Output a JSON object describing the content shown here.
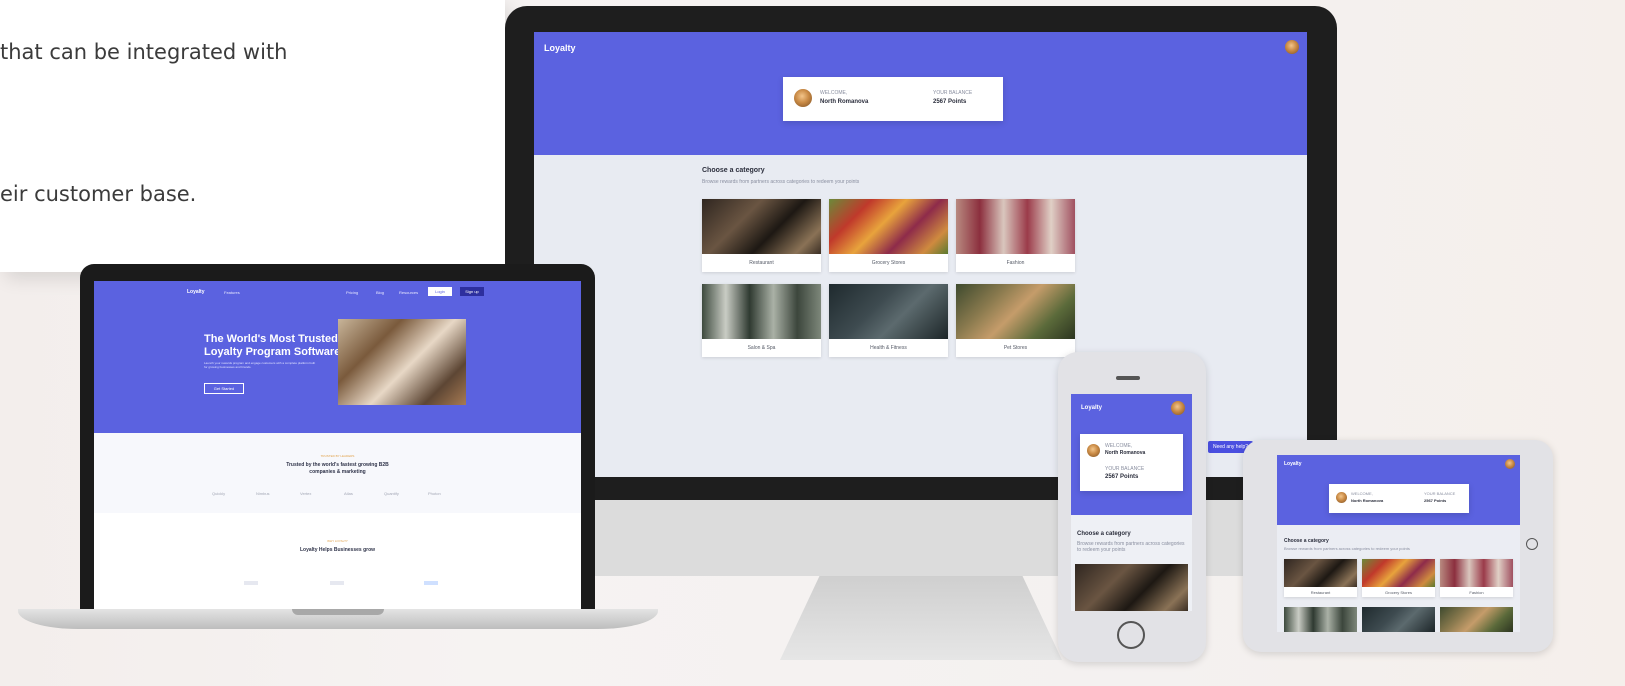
{
  "intro": {
    "line1": "that can be integrated with",
    "line2": "eir customer base."
  },
  "monitor_app": {
    "logo": "Loyalty",
    "profile": {
      "welcome_label": "WELCOME,",
      "name": "North Romanova",
      "balance_label": "YOUR BALANCE",
      "balance_value": "2567 Points"
    },
    "section_title": "Choose a category",
    "section_subtitle": "Browse rewards from partners across categories to redeem your points",
    "categories": [
      {
        "label": "Restaurant"
      },
      {
        "label": "Grocery Stores"
      },
      {
        "label": "Fashion"
      },
      {
        "label": "Salon & Spa"
      },
      {
        "label": "Health & Fitness"
      },
      {
        "label": "Pet Stores"
      }
    ],
    "help_button": "Need any help?"
  },
  "laptop_site": {
    "logo": "Loyalty",
    "nav_left": "Features",
    "nav": [
      "Pricing",
      "Blog",
      "Resources"
    ],
    "login": "Login",
    "signup": "Sign up",
    "hero_title_1": "The World's Most Trusted",
    "hero_title_2": "Loyalty Program Software",
    "hero_text": "Launch your rewards program and engage customers with a complete platform built for growing businesses and brands.",
    "hero_cta": "Get Started",
    "trusted_kicker": "TRUSTED BY LEADERS",
    "trusted_title_1": "Trusted by the world's fastest growing B2B",
    "trusted_title_2": "companies & marketing",
    "logos": [
      "Quickly",
      "Nimbus",
      "Vertex",
      "Atlas",
      "Quantify",
      "Photon"
    ],
    "why_kicker": "WHY LOYALTY",
    "why_title": "Loyalty Helps Businesses grow"
  },
  "phone_app": {
    "logo": "Loyalty",
    "welcome_label": "WELCOME,",
    "name": "North Romanova",
    "balance_label": "YOUR BALANCE",
    "balance_value": "2567 Points",
    "section_title": "Choose a category",
    "section_subtitle": "Browse rewards from partners across categories to redeem your points"
  },
  "tablet_app": {
    "logo": "Loyalty",
    "welcome_label": "WELCOME,",
    "name": "North Romanova",
    "balance_label": "YOUR BALANCE",
    "balance_value": "2567 Points",
    "section_title": "Choose a category",
    "section_subtitle": "Browse rewards from partners across categories to redeem your points",
    "categories": [
      {
        "label": "Restaurant"
      },
      {
        "label": "Grocery Stores"
      },
      {
        "label": "Fashion"
      }
    ]
  },
  "colors": {
    "brand": "#5b62e0",
    "brand_dark": "#2d2f9e",
    "background_screen": "#e8ebf2"
  }
}
